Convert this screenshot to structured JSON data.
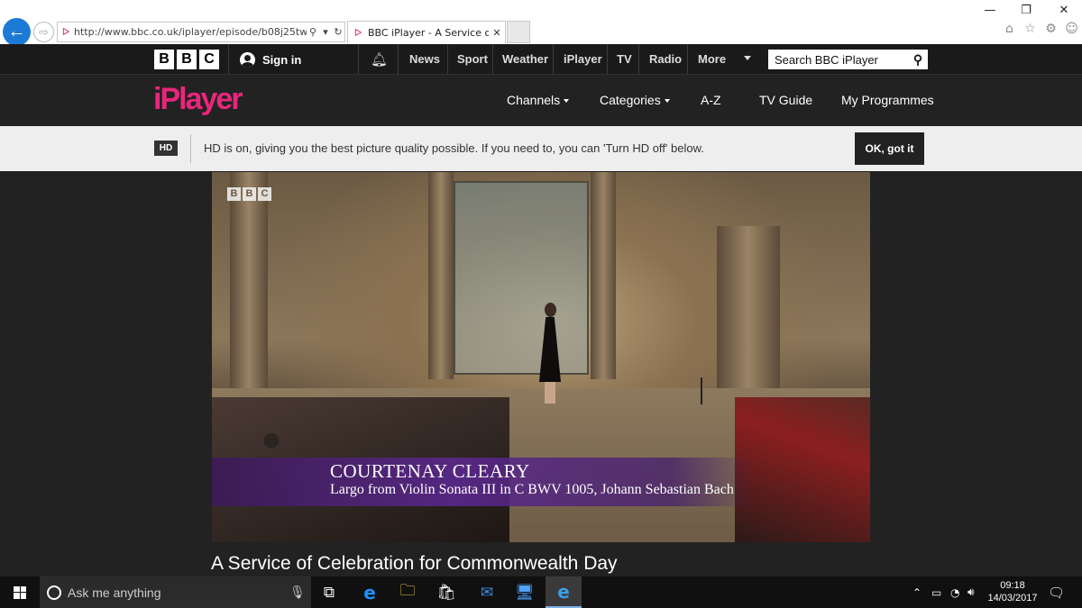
{
  "browser": {
    "address": "http://www.bbc.co.uk/iplayer/episode/b08j25tw/a-ser",
    "tab_title": "BBC iPlayer - A Service of C...",
    "controls": {
      "minimize": "—",
      "restore": "❐",
      "close": "✕"
    }
  },
  "bbc_nav": {
    "logo_letters": [
      "B",
      "B",
      "C"
    ],
    "sign_in": "Sign in",
    "links": [
      "News",
      "Sport",
      "Weather",
      "iPlayer",
      "TV",
      "Radio",
      "More"
    ],
    "search_placeholder": "Search BBC iPlayer"
  },
  "iplayer_header": {
    "logo": "iPlayer",
    "nav": [
      "Channels",
      "Categories",
      "A-Z",
      "TV Guide",
      "My Programmes"
    ]
  },
  "hd_banner": {
    "badge": "HD",
    "message": "HD is on, giving you the best picture quality possible. If you need to, you can 'Turn HD off' below.",
    "button": "OK, got it"
  },
  "player": {
    "watermark_letters": [
      "B",
      "B",
      "C"
    ],
    "caption_name": "COURTENAY CLEARY",
    "caption_detail": "Largo from Violin Sonata III in C BWV 1005, Johann Sebastian Bach"
  },
  "episode": {
    "title": "A Service of Celebration for Commonwealth Day"
  },
  "taskbar": {
    "search_placeholder": "Ask me anything",
    "time": "09:18",
    "date": "14/03/2017"
  }
}
